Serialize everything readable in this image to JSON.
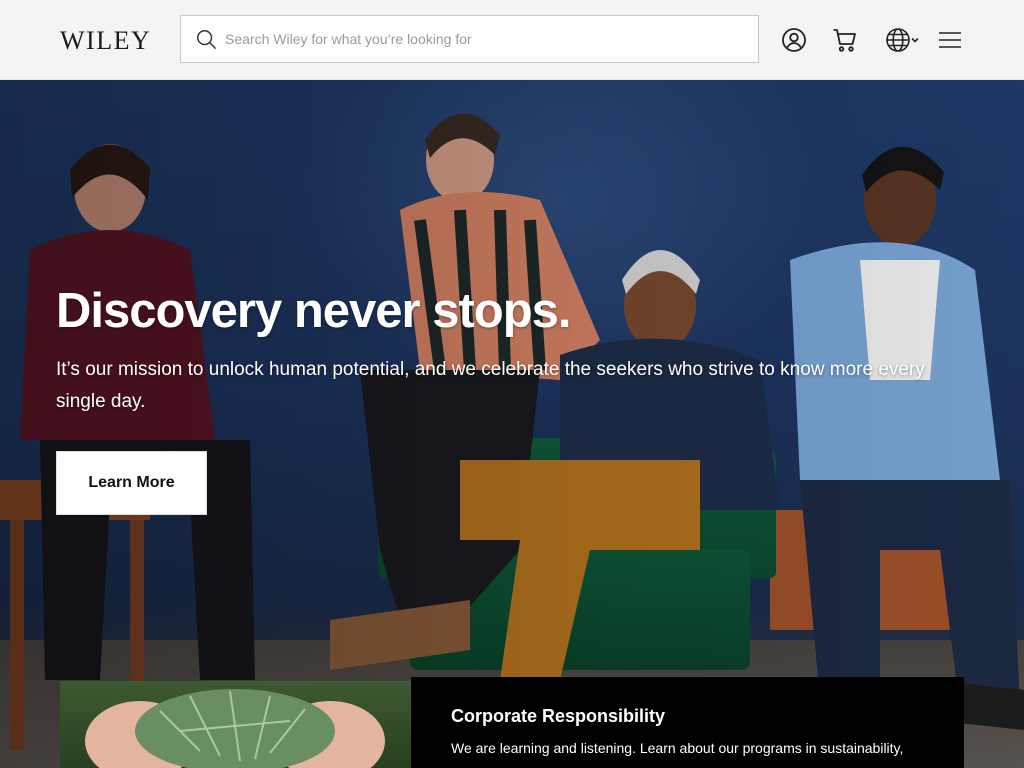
{
  "header": {
    "logo": "WILEY",
    "search_placeholder": "Search Wiley for what you’re looking for",
    "icons": [
      "search-icon",
      "account-icon",
      "cart-icon",
      "globe-icon",
      "chevron-down-icon",
      "menu-icon"
    ]
  },
  "hero": {
    "title": "Discovery never stops.",
    "text": "It’s our mission to unlock human potential, and we celebrate the seekers who strive to know more every single day.",
    "button_label": "Learn More"
  },
  "card": {
    "title": "Corporate Responsibility",
    "text": "We are learning and listening. Learn about our programs in sustainability,"
  },
  "colors": {
    "header_bg": "#f4f4f4",
    "hero_bg": "#1f3a68",
    "card_bg": "#000000",
    "button_bg": "#ffffff"
  }
}
